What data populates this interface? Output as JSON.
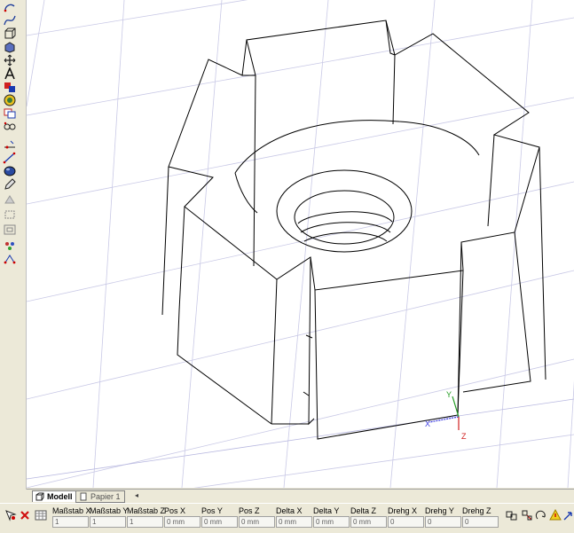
{
  "tabs": [
    {
      "label": "Modell",
      "active": true
    },
    {
      "label": "Papier 1",
      "active": false
    }
  ],
  "properties": [
    {
      "label": "Maßstab X",
      "value": "1"
    },
    {
      "label": "Maßstab Y",
      "value": "1"
    },
    {
      "label": "Maßstab Z",
      "value": "1"
    },
    {
      "label": "Pos X",
      "value": "0 mm"
    },
    {
      "label": "Pos Y",
      "value": "0 mm"
    },
    {
      "label": "Pos Z",
      "value": "0 mm"
    },
    {
      "label": "Delta X",
      "value": "0 mm"
    },
    {
      "label": "Delta Y",
      "value": "0 mm"
    },
    {
      "label": "Delta Z",
      "value": "0 mm"
    },
    {
      "label": "Drehg X",
      "value": "0"
    },
    {
      "label": "Drehg Y",
      "value": "0"
    },
    {
      "label": "Drehg Z",
      "value": "0"
    }
  ],
  "axes": {
    "x": "X",
    "y": "Y",
    "z": "Z"
  },
  "colors": {
    "grid": "#c9c9e6",
    "axis_x": "#3a3ae0",
    "axis_y": "#1f9a1f",
    "axis_z": "#d02020",
    "edges": "#000000"
  },
  "icons": {
    "left_toolbar": [
      "arc-tool-icon",
      "spline-tool-icon",
      "extrude-icon",
      "solid-icon",
      "move-icon",
      "text-icon",
      "layer-color-icon",
      "target-icon",
      "copy-icon",
      "link-icon",
      "snap-point-icon",
      "measure-icon",
      "sphere-icon",
      "edit-icon",
      "hatch-icon",
      "rectangle-select-icon",
      "frame-icon",
      "group-icon",
      "transform-icon"
    ],
    "property_bar": [
      "pick-tool-icon",
      "cancel-icon",
      "grid-icon",
      "hinge-icon",
      "align-icon",
      "rotate-icon",
      "warning-icon",
      "arrow-icon"
    ]
  }
}
